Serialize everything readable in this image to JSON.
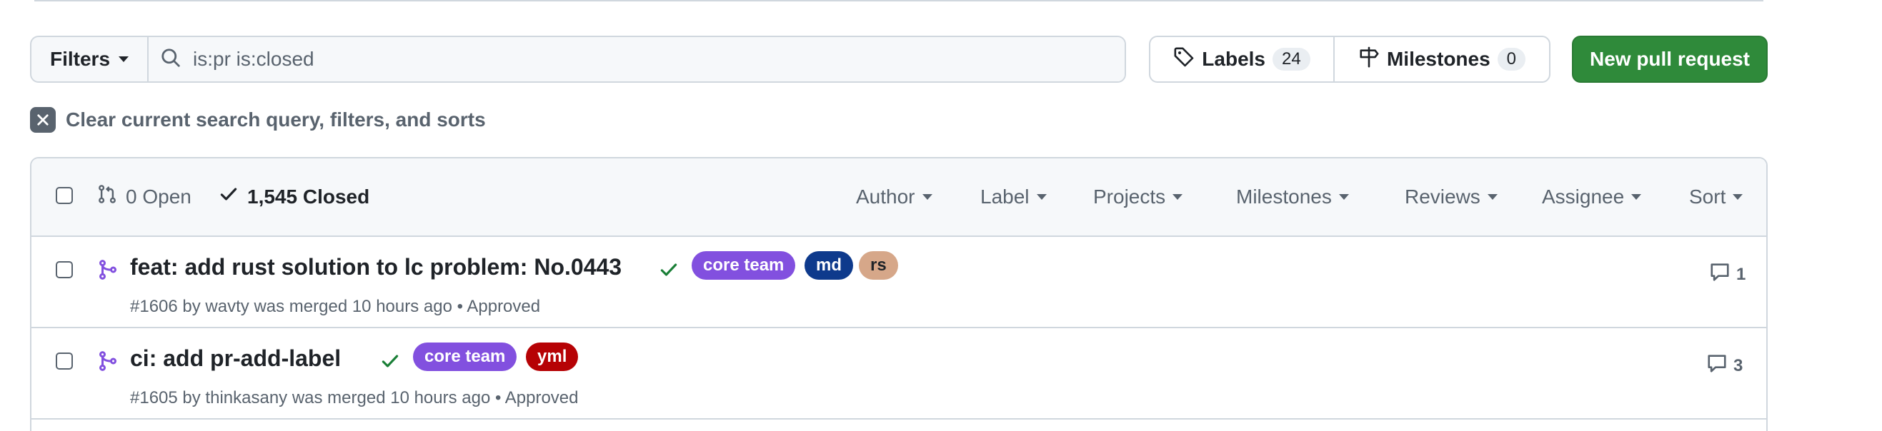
{
  "filter_bar": {
    "filters_label": "Filters",
    "search_value": "is:pr is:closed"
  },
  "labels_button": {
    "label": "Labels",
    "count": "24"
  },
  "milestones_button": {
    "label": "Milestones",
    "count": "0"
  },
  "new_pr_button": {
    "label": "New pull request"
  },
  "clear_search": {
    "label": "Clear current search query, filters, and sorts"
  },
  "table_header": {
    "open_label": "0 Open",
    "closed_label": "1,545 Closed",
    "filters": [
      "Author",
      "Label",
      "Projects",
      "Milestones",
      "Reviews",
      "Assignee",
      "Sort"
    ]
  },
  "pull_requests": [
    {
      "title": "feat: add rust solution to lc problem: No.0443",
      "labels": [
        {
          "name": "core team",
          "color": "#8250df"
        },
        {
          "name": "md",
          "color": "#0e3a8c"
        },
        {
          "name": "rs",
          "color": "#d6a789"
        }
      ],
      "meta": "#1606 by wavty was merged 10 hours ago",
      "review": "Approved",
      "comments": "1"
    },
    {
      "title": "ci: add pr-add-label",
      "labels": [
        {
          "name": "core team",
          "color": "#8250df"
        },
        {
          "name": "yml",
          "color": "#b60205"
        }
      ],
      "meta": "#1605 by thinkasany was merged 10 hours ago",
      "review": "Approved",
      "comments": "3"
    }
  ],
  "colors": {
    "accent_green": "#2f8a3a",
    "merged_purple": "#8250df",
    "check_green": "#1a7f37",
    "muted_text": "#59636e"
  },
  "icons": [
    "search-icon",
    "tag-icon",
    "milestone-icon",
    "close-icon",
    "git-pull-request-icon",
    "check-icon",
    "git-merge-icon",
    "comment-icon"
  ]
}
